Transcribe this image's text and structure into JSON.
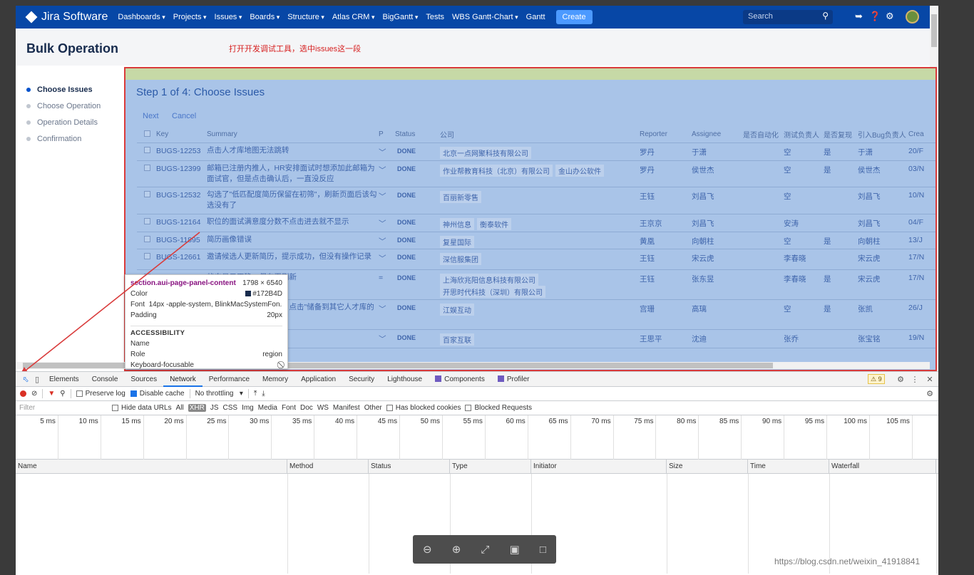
{
  "topnav": {
    "logo": "Jira Software",
    "items": [
      {
        "label": "Dashboards",
        "dropdown": true
      },
      {
        "label": "Projects",
        "dropdown": true
      },
      {
        "label": "Issues",
        "dropdown": true
      },
      {
        "label": "Boards",
        "dropdown": true
      },
      {
        "label": "Structure",
        "dropdown": true
      },
      {
        "label": "Atlas CRM",
        "dropdown": true
      },
      {
        "label": "BigGantt",
        "dropdown": true
      },
      {
        "label": "Tests",
        "dropdown": false
      },
      {
        "label": "WBS Gantt-Chart",
        "dropdown": true
      },
      {
        "label": "Gantt",
        "dropdown": false
      }
    ],
    "create": "Create",
    "search_placeholder": "Search",
    "icons": [
      "search-icon",
      "megaphone-icon",
      "help-icon",
      "gear-icon",
      "avatar"
    ]
  },
  "page": {
    "title": "Bulk Operation",
    "annotation": "打开开发调试工具，选中issues这一段"
  },
  "steps": [
    {
      "label": "Choose Issues",
      "active": true
    },
    {
      "label": "Choose Operation",
      "active": false
    },
    {
      "label": "Operation Details",
      "active": false
    },
    {
      "label": "Confirmation",
      "active": false
    }
  ],
  "panel": {
    "title": "Step 1 of 4: Choose Issues",
    "next": "Next",
    "cancel": "Cancel",
    "columns": [
      "",
      "Key",
      "Summary",
      "P",
      "Status",
      "公司",
      "Reporter",
      "Assignee",
      "是否自动化",
      "测试负责人",
      "是否复现",
      "引入Bug负责人",
      "Crea"
    ],
    "rows": [
      {
        "key": "BUGS-12253",
        "summary": "点击人才库地图无法跳转",
        "priority": "﹀",
        "status": "DONE",
        "companies": [
          "北京一点网聚科技有限公司"
        ],
        "reporter": "罗丹",
        "assignee": "于潇",
        "auto": "",
        "tester": "空",
        "repro": "是",
        "bug_owner": "于潇",
        "created": "20/F"
      },
      {
        "key": "BUGS-12399",
        "summary": "邮箱已注册内推人，HR安排面试时想添加此邮箱为面试官，但是点击确认后，一直没反应",
        "priority": "﹀",
        "status": "DONE",
        "companies": [
          "作业帮教育科技（北京）有限公司",
          "金山办公软件"
        ],
        "reporter": "罗丹",
        "assignee": "侯世杰",
        "auto": "",
        "tester": "空",
        "repro": "是",
        "bug_owner": "侯世杰",
        "created": "03/N"
      },
      {
        "key": "BUGS-12532",
        "summary": "勾选了\"低匹配度简历保留在初筛\"，刷新页面后该勾选没有了",
        "priority": "﹀",
        "status": "DONE",
        "companies": [
          "百丽新零售"
        ],
        "reporter": "王钰",
        "assignee": "刘昌飞",
        "auto": "",
        "tester": "空",
        "repro": "",
        "bug_owner": "刘昌飞",
        "created": "10/N"
      },
      {
        "key": "BUGS-12164",
        "summary": "职位的面试满意度分数不点击进去就不显示",
        "priority": "﹀",
        "status": "DONE",
        "companies": [
          "神州信息",
          "衡泰软件"
        ],
        "reporter": "王京京",
        "assignee": "刘昌飞",
        "auto": "",
        "tester": "安涛",
        "repro": "",
        "bug_owner": "刘昌飞",
        "created": "04/F"
      },
      {
        "key": "BUGS-11895",
        "summary": "简历画像错误",
        "priority": "﹀",
        "status": "DONE",
        "companies": [
          "复星国际"
        ],
        "reporter": "黄凰",
        "assignee": "向朝柱",
        "auto": "",
        "tester": "空",
        "repro": "是",
        "bug_owner": "向朝柱",
        "created": "13/J"
      },
      {
        "key": "BUGS-12661",
        "summary": "邀请候选人更新简历，提示成功，但没有操作记录",
        "priority": "﹀",
        "status": "DONE",
        "companies": [
          "深信服集团"
        ],
        "reporter": "王钰",
        "assignee": "宋云虎",
        "auto": "",
        "tester": "李春晓",
        "repro": "",
        "bug_owner": "宋云虎",
        "created": "17/N"
      },
      {
        "key": "",
        "summary": "状态显示正确，保存再刷新",
        "priority": "=",
        "status": "DONE",
        "companies": [
          "上海欣兆阳信息科技有限公司",
          "开思时代科技（深圳）有限公司"
        ],
        "reporter": "王钰",
        "assignee": "张东昱",
        "auto": "",
        "tester": "李春晓",
        "repro": "是",
        "bug_owner": "宋云虎",
        "created": "17/N"
      },
      {
        "key": "",
        "summary": "系统公共人才池的候选，点击\"储备到其它人才库的列表",
        "priority": "﹀",
        "status": "DONE",
        "companies": [
          "江娱互动"
        ],
        "reporter": "宫珊",
        "assignee": "高璃",
        "auto": "",
        "tester": "空",
        "repro": "是",
        "bug_owner": "张凯",
        "created": "26/J"
      },
      {
        "key": "",
        "summary": "",
        "priority": "﹀",
        "status": "DONE",
        "companies": [
          "百家互联"
        ],
        "reporter": "王思平",
        "assignee": "沈迪",
        "auto": "",
        "tester": "张乔",
        "repro": "",
        "bug_owner": "张宝铭",
        "created": "19/N"
      }
    ]
  },
  "inspector": {
    "selector": "section.aui-page-panel-content",
    "size": "1798 × 6540",
    "color_label": "Color",
    "color_value": "#172B4D",
    "font_label": "Font",
    "font_value": "14px -apple-system, BlinkMacSystemFon...",
    "padding_label": "Padding",
    "padding_value": "20px",
    "accessibility": "ACCESSIBILITY",
    "name_label": "Name",
    "role_label": "Role",
    "role_value": "region",
    "focus_label": "Keyboard-focusable",
    "focus_value": "⃠"
  },
  "devtools": {
    "tabs": [
      "Elements",
      "Console",
      "Sources",
      "Network",
      "Performance",
      "Memory",
      "Application",
      "Security",
      "Lighthouse",
      "Components",
      "Profiler"
    ],
    "active_tab": "Network",
    "warnings": "⚠ 9",
    "toolbar": {
      "preserve_log": "Preserve log",
      "disable_cache": "Disable cache",
      "throttling": "No throttling"
    },
    "filter": {
      "placeholder": "Filter",
      "hide_data_urls": "Hide data URLs",
      "types": [
        "All",
        "XHR",
        "JS",
        "CSS",
        "Img",
        "Media",
        "Font",
        "Doc",
        "WS",
        "Manifest",
        "Other"
      ],
      "selected_type": "XHR",
      "has_blocked_cookies": "Has blocked cookies",
      "blocked_requests": "Blocked Requests"
    },
    "timeline_ticks": [
      "5 ms",
      "10 ms",
      "15 ms",
      "20 ms",
      "25 ms",
      "30 ms",
      "35 ms",
      "40 ms",
      "45 ms",
      "50 ms",
      "55 ms",
      "60 ms",
      "65 ms",
      "70 ms",
      "75 ms",
      "80 ms",
      "85 ms",
      "90 ms",
      "95 ms",
      "100 ms",
      "105 ms",
      "11"
    ],
    "columns": [
      "Name",
      "Method",
      "Status",
      "Type",
      "Initiator",
      "Size",
      "Time",
      "Waterfall"
    ]
  },
  "viewer_icons": [
    "zoom-out-icon",
    "zoom-in-icon",
    "fullscreen-icon",
    "image-icon",
    "comment-icon"
  ],
  "watermark": "https://blog.csdn.net/weixin_41918841"
}
